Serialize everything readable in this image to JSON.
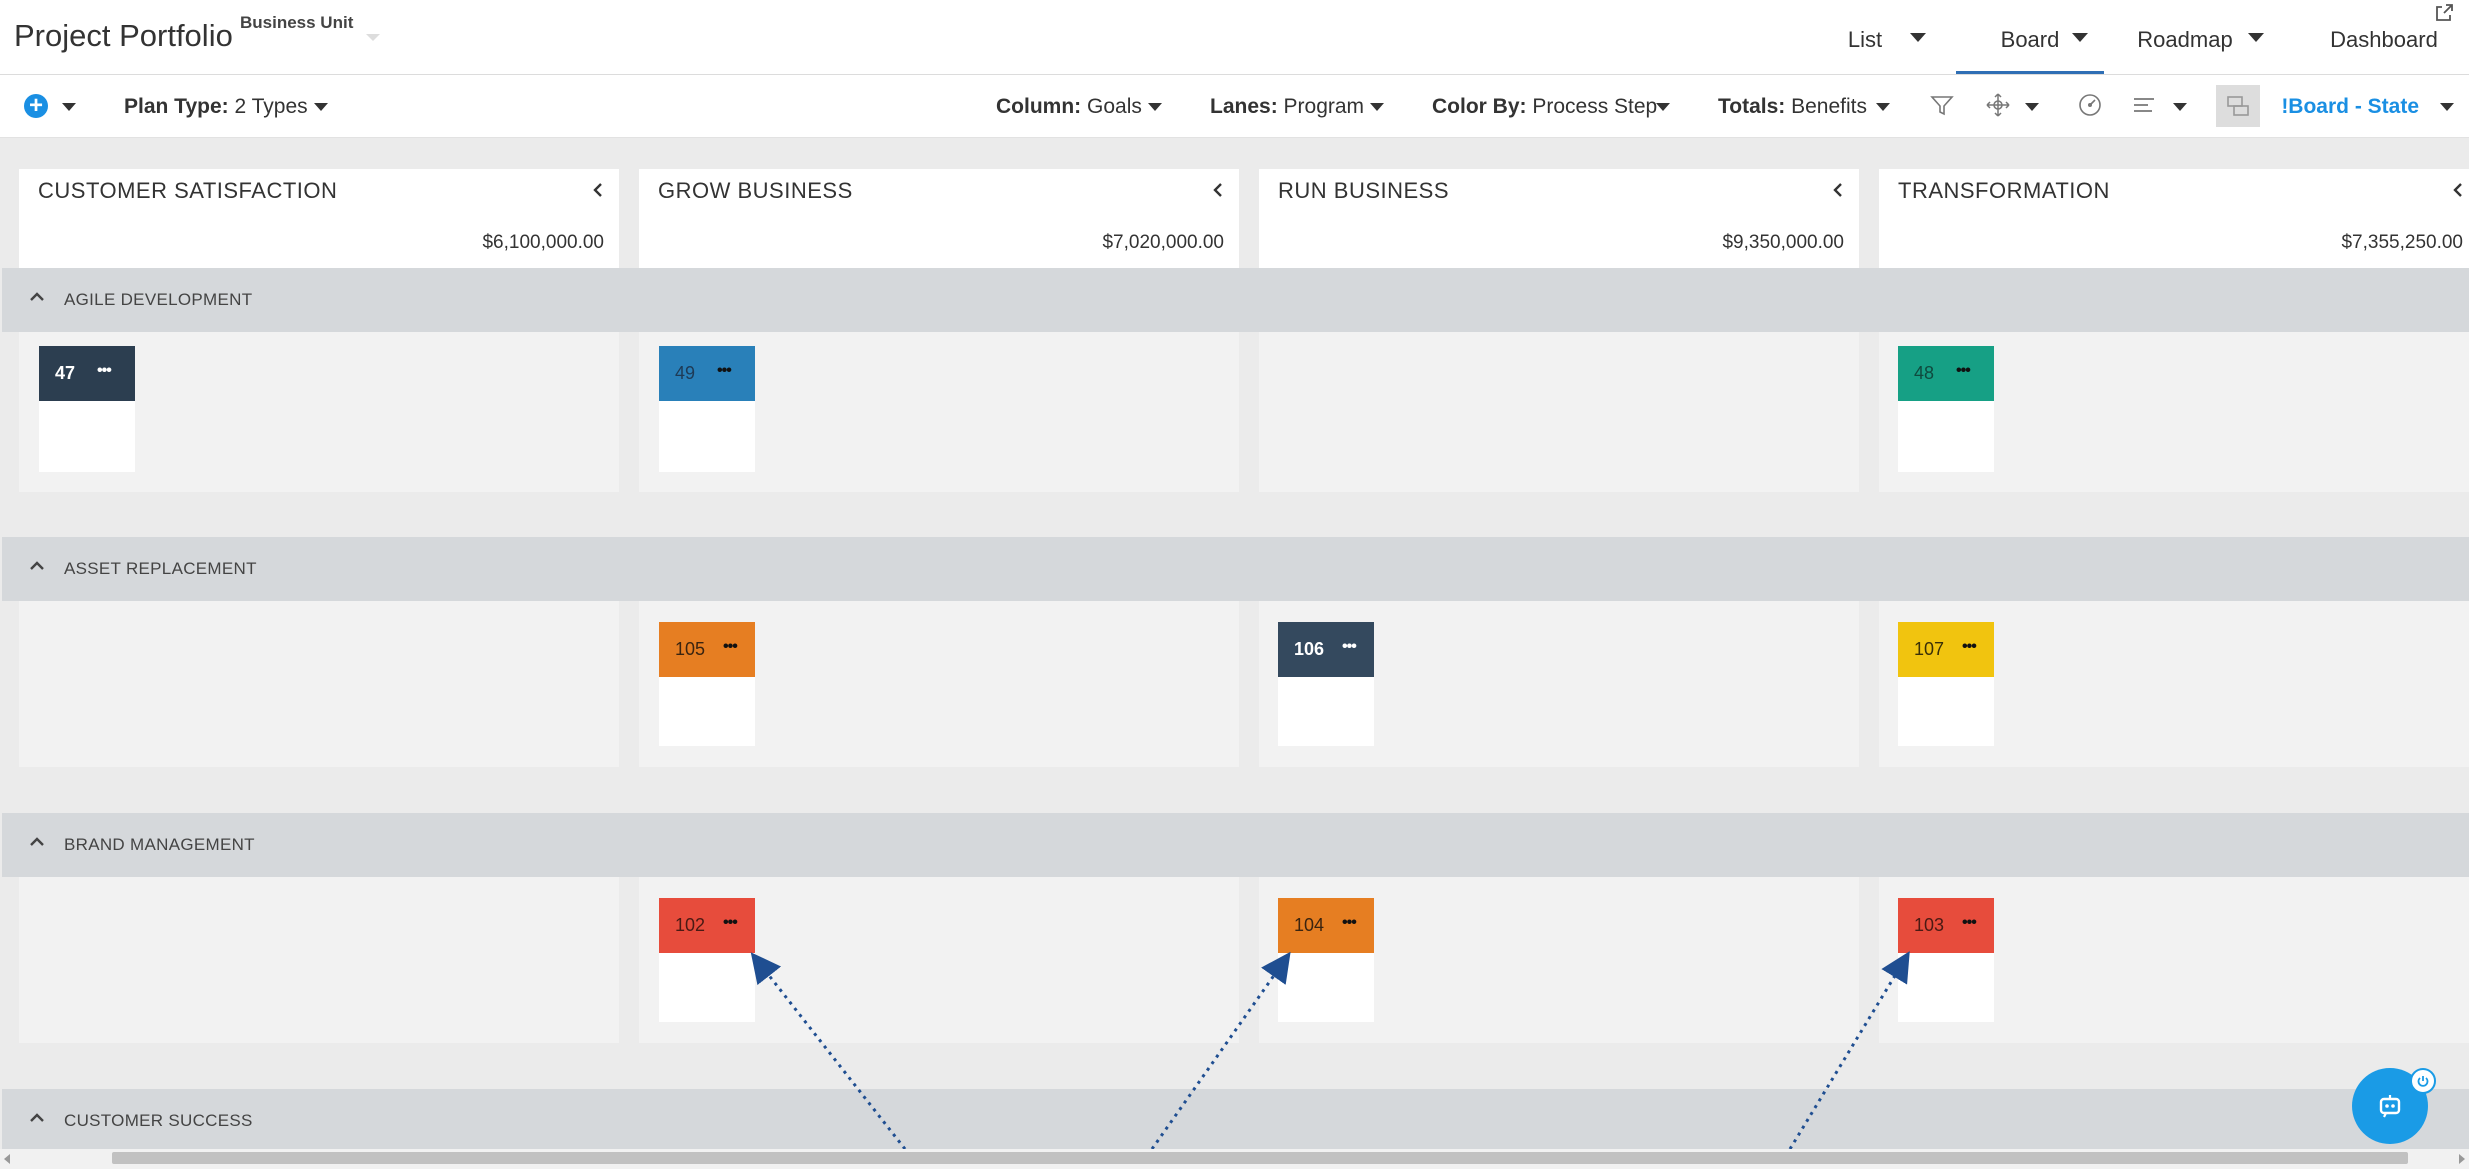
{
  "header": {
    "app_title": "Project Portfolio",
    "business_unit_label": "Business Unit",
    "views": [
      {
        "label": "List"
      },
      {
        "label": "Board"
      },
      {
        "label": "Roadmap"
      },
      {
        "label": "Dashboard"
      }
    ],
    "active_view": "Board"
  },
  "toolbar": {
    "plan_type": {
      "label": "Plan Type:",
      "value": "2 Types"
    },
    "column": {
      "label": "Column:",
      "value": "Goals"
    },
    "lanes": {
      "label": "Lanes:",
      "value": "Program"
    },
    "color_by": {
      "label": "Color By:",
      "value": "Process Step"
    },
    "totals": {
      "label": "Totals:",
      "value": "Benefits"
    },
    "view_name": "!Board - State"
  },
  "columns": [
    {
      "title": "CUSTOMER SATISFACTION",
      "total": "$6,100,000.00"
    },
    {
      "title": "GROW BUSINESS",
      "total": "$7,020,000.00"
    },
    {
      "title": "RUN BUSINESS",
      "total": "$9,350,000.00"
    },
    {
      "title": "TRANSFORMATION",
      "total": "$7,355,250.00"
    }
  ],
  "lanes": [
    {
      "title": "AGILE DEVELOPMENT",
      "cards": [
        {
          "id": "47",
          "column": 0,
          "color": "#2c3e50",
          "text_color": "#ffffff"
        },
        {
          "id": "49",
          "column": 1,
          "color": "#2980b9",
          "text_color": "#1e3a55"
        },
        {
          "id": "48",
          "column": 3,
          "color": "#16a085",
          "text_color": "#0f4a3e"
        }
      ]
    },
    {
      "title": "ASSET REPLACEMENT",
      "cards": [
        {
          "id": "105",
          "column": 1,
          "color": "#e67e22",
          "text_color": "#3a2410"
        },
        {
          "id": "106",
          "column": 2,
          "color": "#34495e",
          "text_color": "#ffffff"
        },
        {
          "id": "107",
          "column": 3,
          "color": "#f1c40f",
          "text_color": "#3a3008"
        }
      ]
    },
    {
      "title": "BRAND MANAGEMENT",
      "cards": [
        {
          "id": "102",
          "column": 1,
          "color": "#e74c3c",
          "text_color": "#4a1a14"
        },
        {
          "id": "104",
          "column": 2,
          "color": "#e67e22",
          "text_color": "#3a2410"
        },
        {
          "id": "103",
          "column": 3,
          "color": "#e74c3c",
          "text_color": "#4a1a14"
        }
      ]
    },
    {
      "title": "CUSTOMER SUCCESS",
      "cards": []
    }
  ],
  "colors": {
    "accent": "#1a8fe3",
    "active_tab_underline": "#2f6fb5",
    "lane_header": "#d5d8db",
    "arrow": "#1f4e91"
  },
  "icons": [
    "add-icon",
    "filter-icon",
    "move-icon",
    "gauge-icon",
    "align-icon",
    "layout-icon",
    "expand-icon",
    "collapse-column-icon",
    "chevron-up-icon",
    "more-icon",
    "assistant-icon",
    "power-icon"
  ]
}
